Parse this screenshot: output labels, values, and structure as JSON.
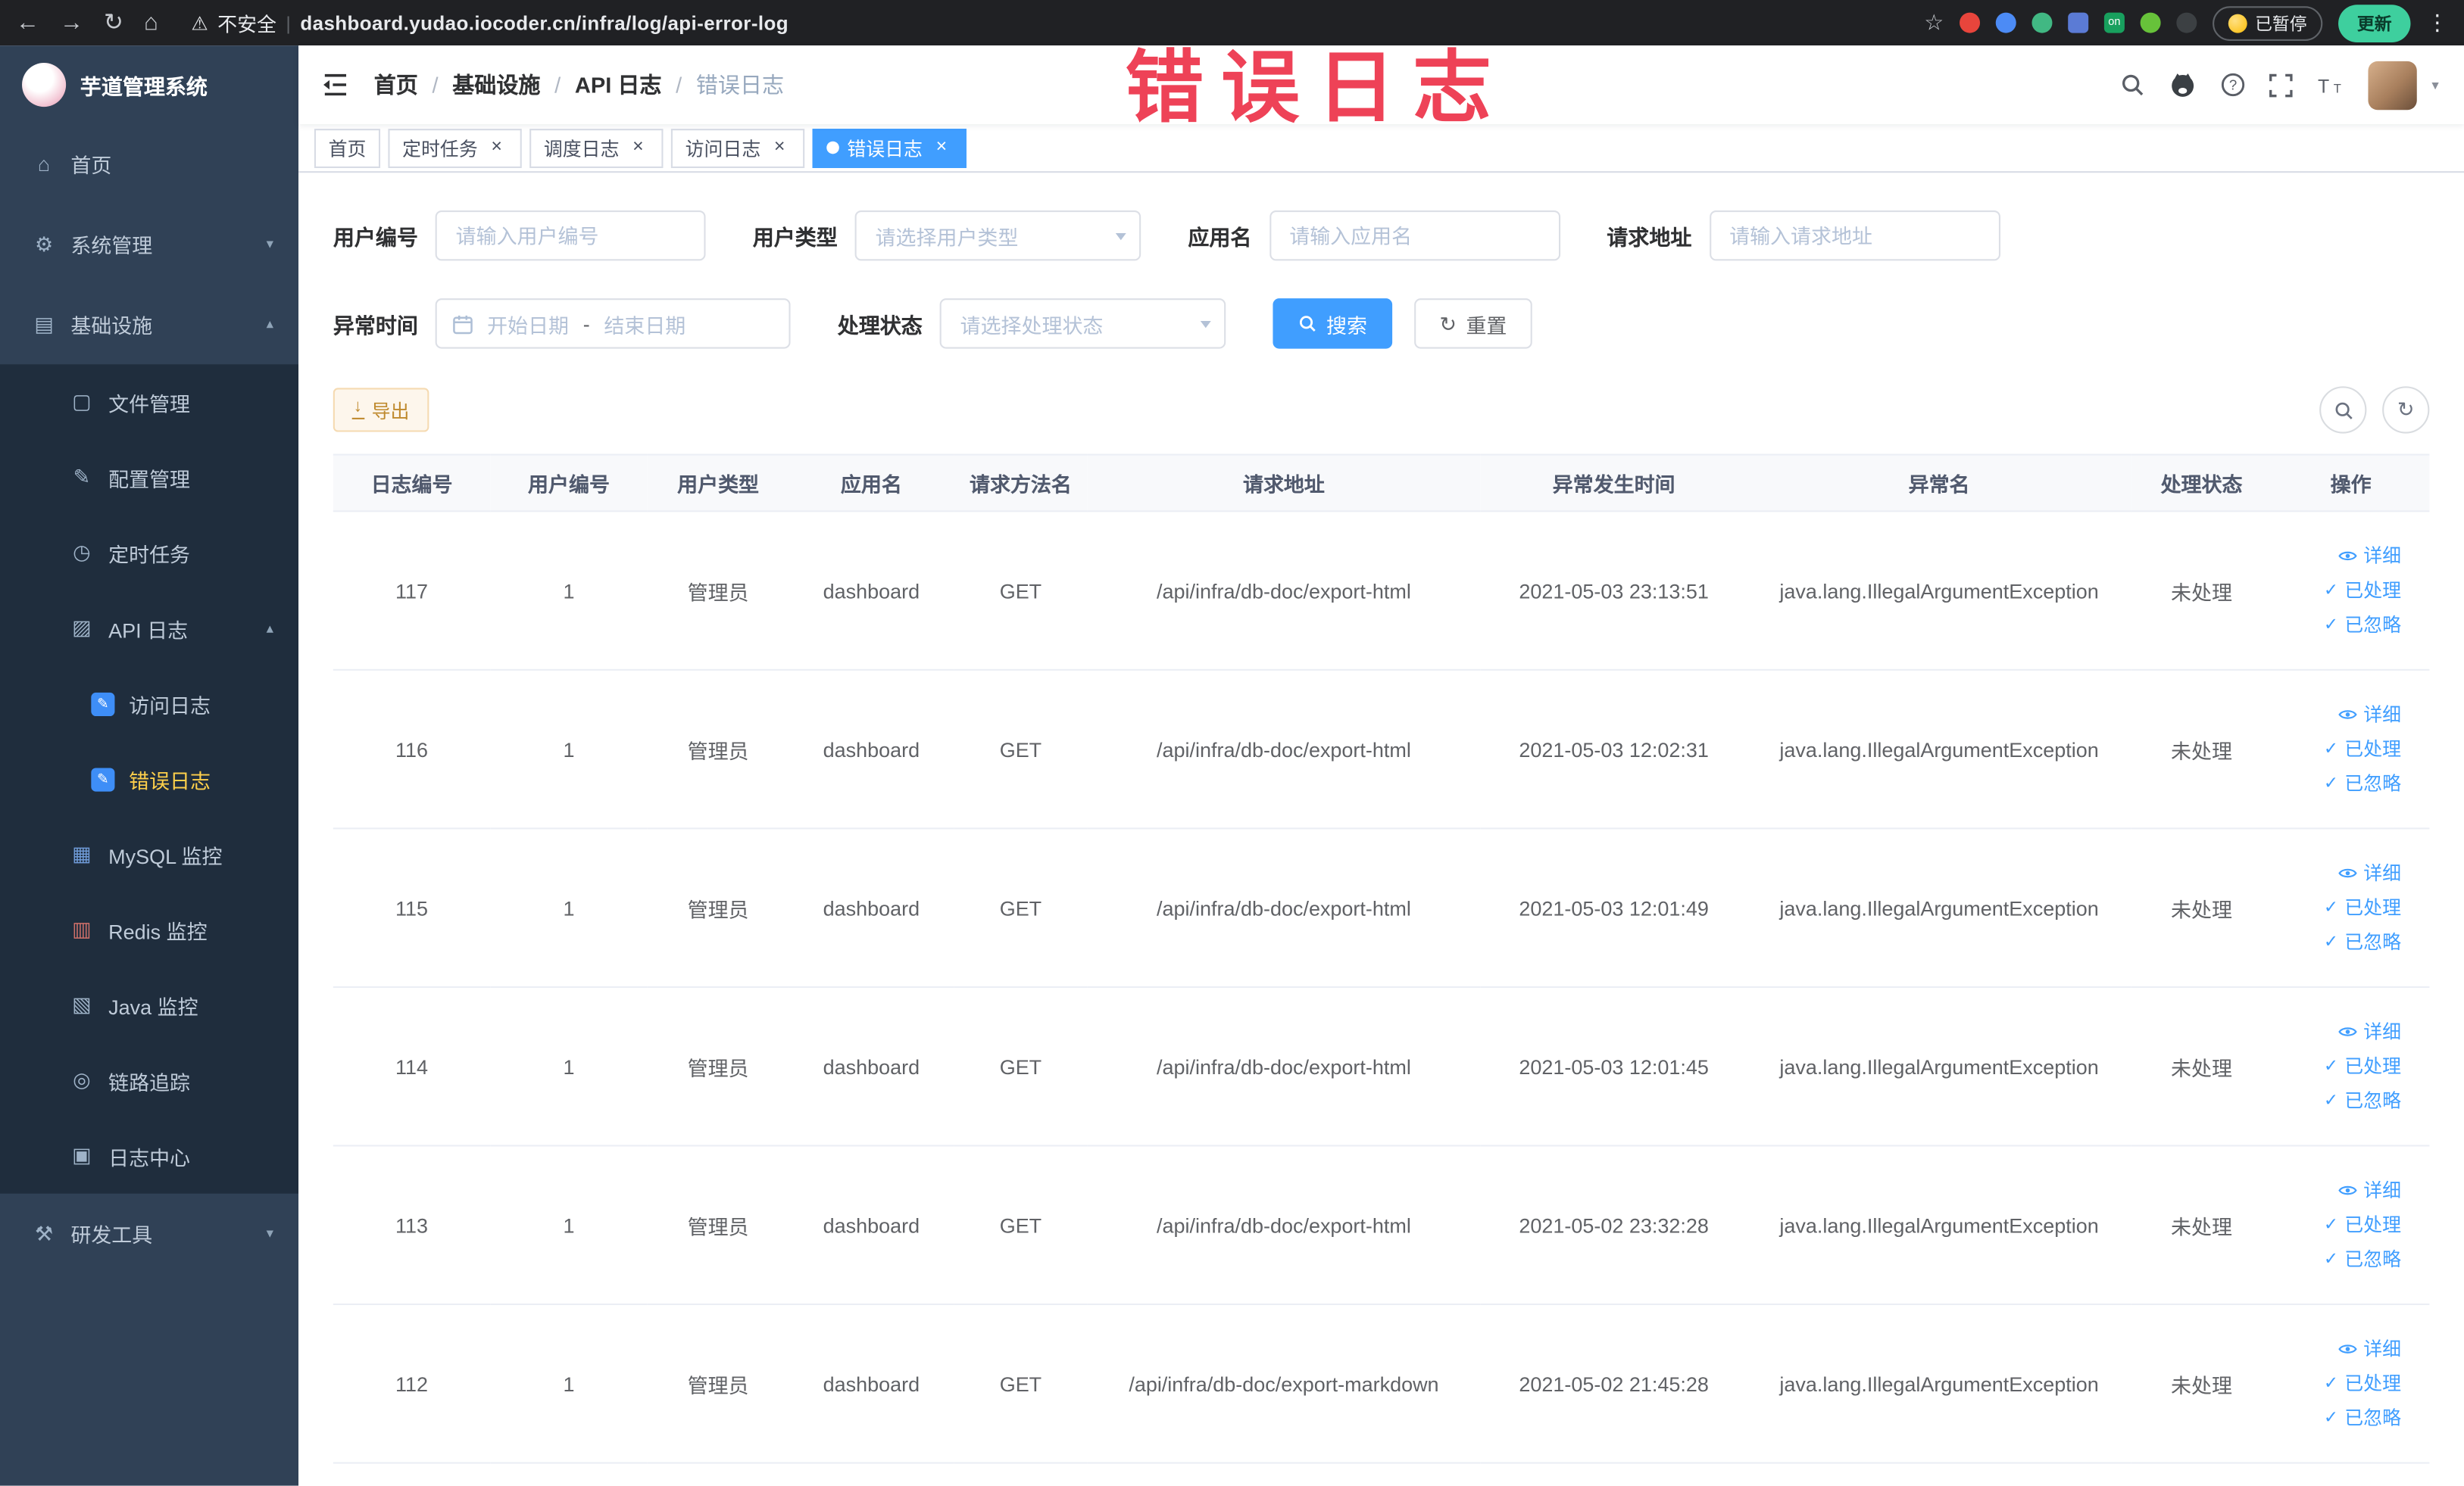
{
  "browser": {
    "security_label": "不安全",
    "url": "dashboard.yudao.iocoder.cn/infra/log/api-error-log",
    "paused_badge": "已暂停",
    "update_button": "更新"
  },
  "watermark": "错误日志",
  "colors": {
    "accent_blue": "#409eff",
    "sidebar_bg": "#304156",
    "submenu_bg": "#1f2d3d",
    "active_menu_yellow": "#ffd04b",
    "watermark_red": "#ee4257",
    "export_warning_text": "#bf8a2e"
  },
  "icons": {
    "back": "←",
    "forward": "→",
    "reload": "↻",
    "browser_home": "⌂",
    "warning_triangle": "⚠",
    "divider": "|",
    "star": "☆",
    "kebab": "⋮",
    "slash": "/",
    "chevron_down": "▾",
    "chevron_up": "▴",
    "caret_down": "▾",
    "close": "×",
    "check": "✓",
    "refresh": "↻",
    "download_arrow": "↓",
    "ext_on_label": "on",
    "sidebar": {
      "home": "⌂",
      "system": "⚙",
      "infra": "▤",
      "file": "▢",
      "config": "✎",
      "job": "◷",
      "api_log": "▨",
      "access_log": "✎",
      "error_log": "✎",
      "mysql": "▦",
      "redis": "▥",
      "java": "▧",
      "trace": "◎",
      "log_center": "▣",
      "dev_tools": "⚒"
    }
  },
  "sidebar": {
    "logo_title": "芋道管理系统",
    "items": {
      "home": "首页",
      "system": "系统管理",
      "infra": "基础设施",
      "file": "文件管理",
      "config": "配置管理",
      "job": "定时任务",
      "api_log": "API 日志",
      "access_log": "访问日志",
      "error_log": "错误日志",
      "mysql": "MySQL 监控",
      "redis": "Redis 监控",
      "java": "Java 监控",
      "trace": "链路追踪",
      "log_center": "日志中心",
      "dev_tools": "研发工具"
    }
  },
  "header": {
    "breadcrumb": [
      "首页",
      "基础设施",
      "API 日志",
      "错误日志"
    ]
  },
  "tabs": [
    {
      "label": "首页"
    },
    {
      "label": "定时任务"
    },
    {
      "label": "调度日志"
    },
    {
      "label": "访问日志"
    },
    {
      "label": "错误日志"
    }
  ],
  "filters": {
    "user_id": {
      "label": "用户编号",
      "placeholder": "请输入用户编号"
    },
    "user_type": {
      "label": "用户类型",
      "placeholder": "请选择用户类型"
    },
    "app_name": {
      "label": "应用名",
      "placeholder": "请输入应用名"
    },
    "request_url": {
      "label": "请求地址",
      "placeholder": "请输入请求地址"
    },
    "exception_time": {
      "label": "异常时间",
      "start_placeholder": "开始日期",
      "separator": "-",
      "end_placeholder": "结束日期"
    },
    "process_status": {
      "label": "处理状态",
      "placeholder": "请选择处理状态"
    },
    "search_button": "搜索",
    "reset_button": "重置"
  },
  "toolbar": {
    "export_button": "导出"
  },
  "table": {
    "headers": [
      "日志编号",
      "用户编号",
      "用户类型",
      "应用名",
      "请求方法名",
      "请求地址",
      "异常发生时间",
      "异常名",
      "处理状态",
      "操作"
    ],
    "actions": {
      "detail": "详细",
      "processed": "已处理",
      "ignored": "已忽略"
    },
    "rows": [
      {
        "id": "117",
        "user_id": "1",
        "user_type": "管理员",
        "app": "dashboard",
        "method": "GET",
        "url": "/api/infra/db-doc/export-html",
        "time": "2021-05-03 23:13:51",
        "exception": "java.lang.IllegalArgumentException",
        "status": "未处理"
      },
      {
        "id": "116",
        "user_id": "1",
        "user_type": "管理员",
        "app": "dashboard",
        "method": "GET",
        "url": "/api/infra/db-doc/export-html",
        "time": "2021-05-03 12:02:31",
        "exception": "java.lang.IllegalArgumentException",
        "status": "未处理"
      },
      {
        "id": "115",
        "user_id": "1",
        "user_type": "管理员",
        "app": "dashboard",
        "method": "GET",
        "url": "/api/infra/db-doc/export-html",
        "time": "2021-05-03 12:01:49",
        "exception": "java.lang.IllegalArgumentException",
        "status": "未处理"
      },
      {
        "id": "114",
        "user_id": "1",
        "user_type": "管理员",
        "app": "dashboard",
        "method": "GET",
        "url": "/api/infra/db-doc/export-html",
        "time": "2021-05-03 12:01:45",
        "exception": "java.lang.IllegalArgumentException",
        "status": "未处理"
      },
      {
        "id": "113",
        "user_id": "1",
        "user_type": "管理员",
        "app": "dashboard",
        "method": "GET",
        "url": "/api/infra/db-doc/export-html",
        "time": "2021-05-02 23:32:28",
        "exception": "java.lang.IllegalArgumentException",
        "status": "未处理"
      },
      {
        "id": "112",
        "user_id": "1",
        "user_type": "管理员",
        "app": "dashboard",
        "method": "GET",
        "url": "/api/infra/db-doc/export-markdown",
        "time": "2021-05-02 21:45:28",
        "exception": "java.lang.IllegalArgumentException",
        "status": "未处理"
      }
    ]
  }
}
